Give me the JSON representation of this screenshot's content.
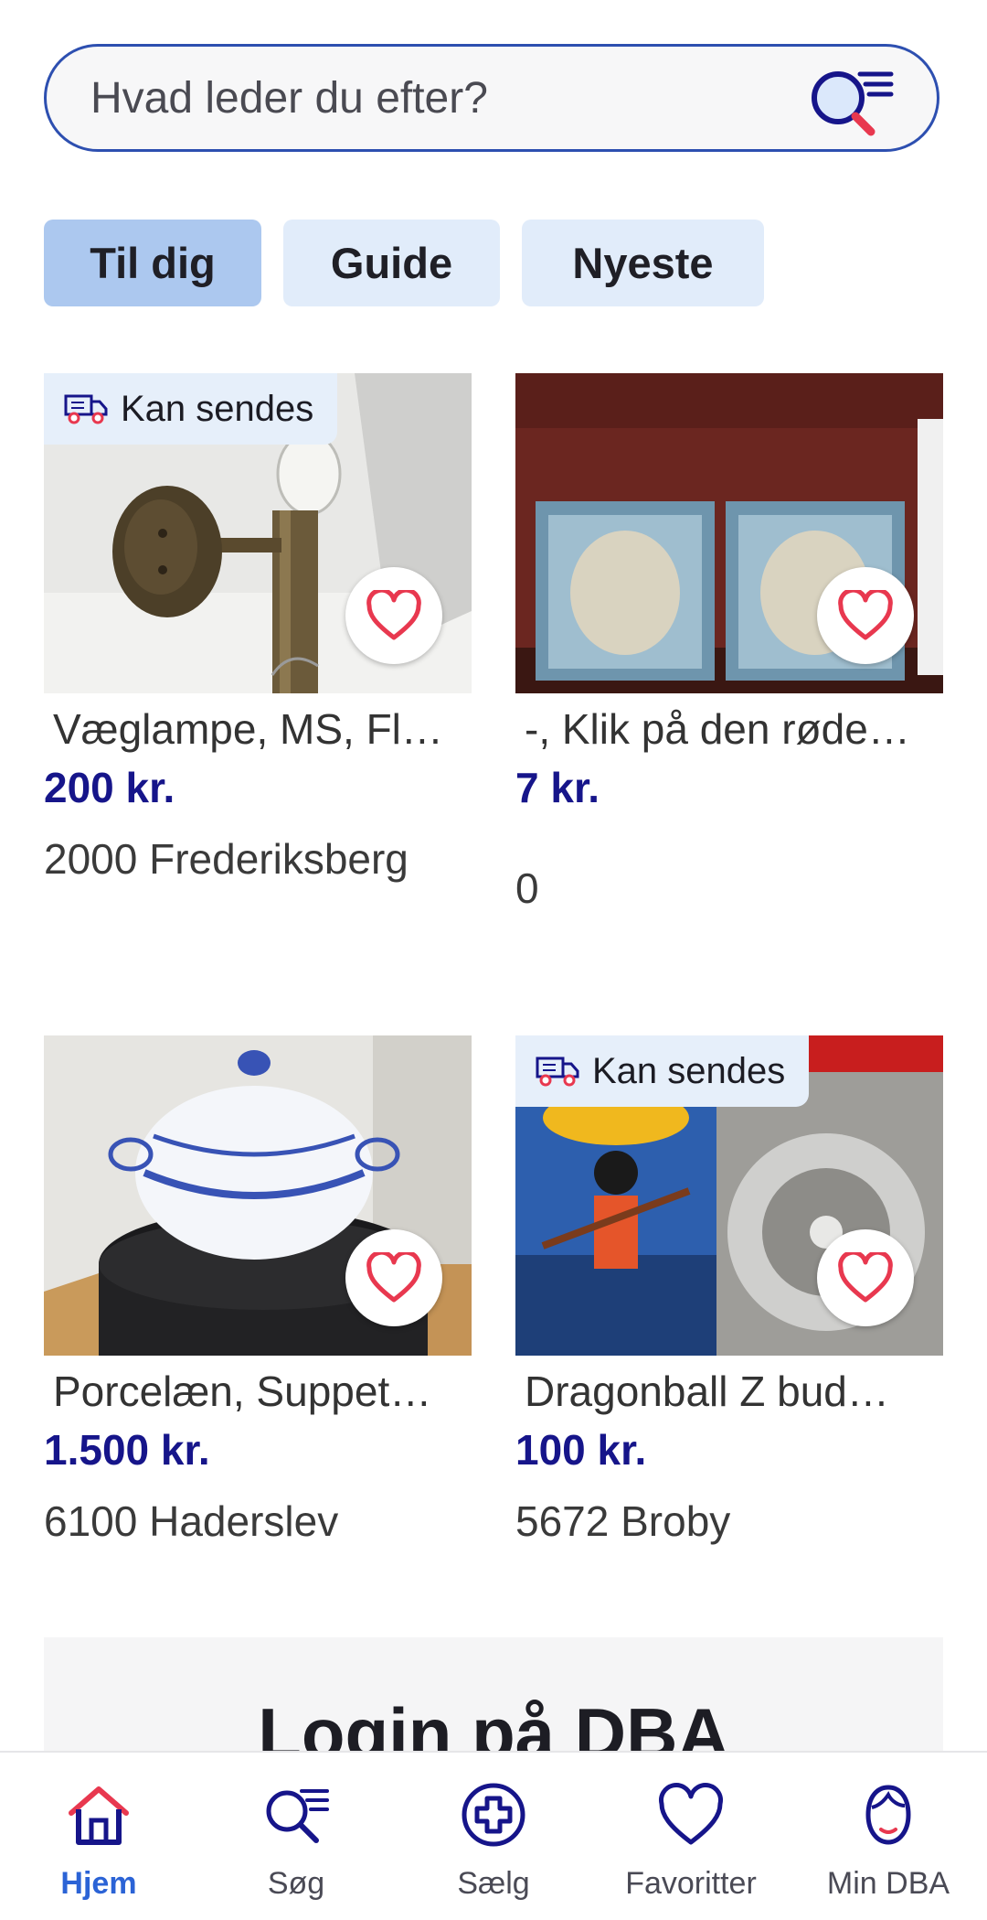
{
  "search": {
    "placeholder": "Hvad leder du efter?"
  },
  "tabs": [
    {
      "label": "Til dig",
      "active": true
    },
    {
      "label": "Guide",
      "active": false
    },
    {
      "label": "Nyeste",
      "active": false
    }
  ],
  "listings": [
    {
      "title": " Væglampe, MS, Fl…",
      "price": "200 kr.",
      "location": "2000 Frederiksberg",
      "badge": "Kan sendes",
      "image_icon": "wall-lamp-photo"
    },
    {
      "title": " -, Klik på den røde…",
      "price": "7 kr.",
      "location": "0",
      "badge": "",
      "image_icon": "stamps-photo"
    },
    {
      "title": " Porcelæn, Suppet…",
      "price": "1.500 kr.",
      "location": "6100 Haderslev",
      "badge": "",
      "image_icon": "porcelain-tureen-photo"
    },
    {
      "title": " Dragonball Z bud…",
      "price": "100 kr.",
      "location": "5672 Broby",
      "badge": "Kan sendes",
      "image_icon": "game-case-photo"
    }
  ],
  "login": {
    "heading": "Login på DBA"
  },
  "nav": [
    {
      "label": "Hjem",
      "icon": "home-icon",
      "active": true
    },
    {
      "label": "Søg",
      "icon": "search-icon",
      "active": false
    },
    {
      "label": "Sælg",
      "icon": "plus-circle-icon",
      "active": false
    },
    {
      "label": "Favoritter",
      "icon": "heart-icon",
      "active": false
    },
    {
      "label": "Min DBA",
      "icon": "profile-icon",
      "active": false
    }
  ],
  "colors": {
    "accent": "#2b63d6",
    "price": "#16158a",
    "heart": "#e8384f",
    "tab_active": "#acc8ef",
    "tab": "#e1ecfa"
  }
}
